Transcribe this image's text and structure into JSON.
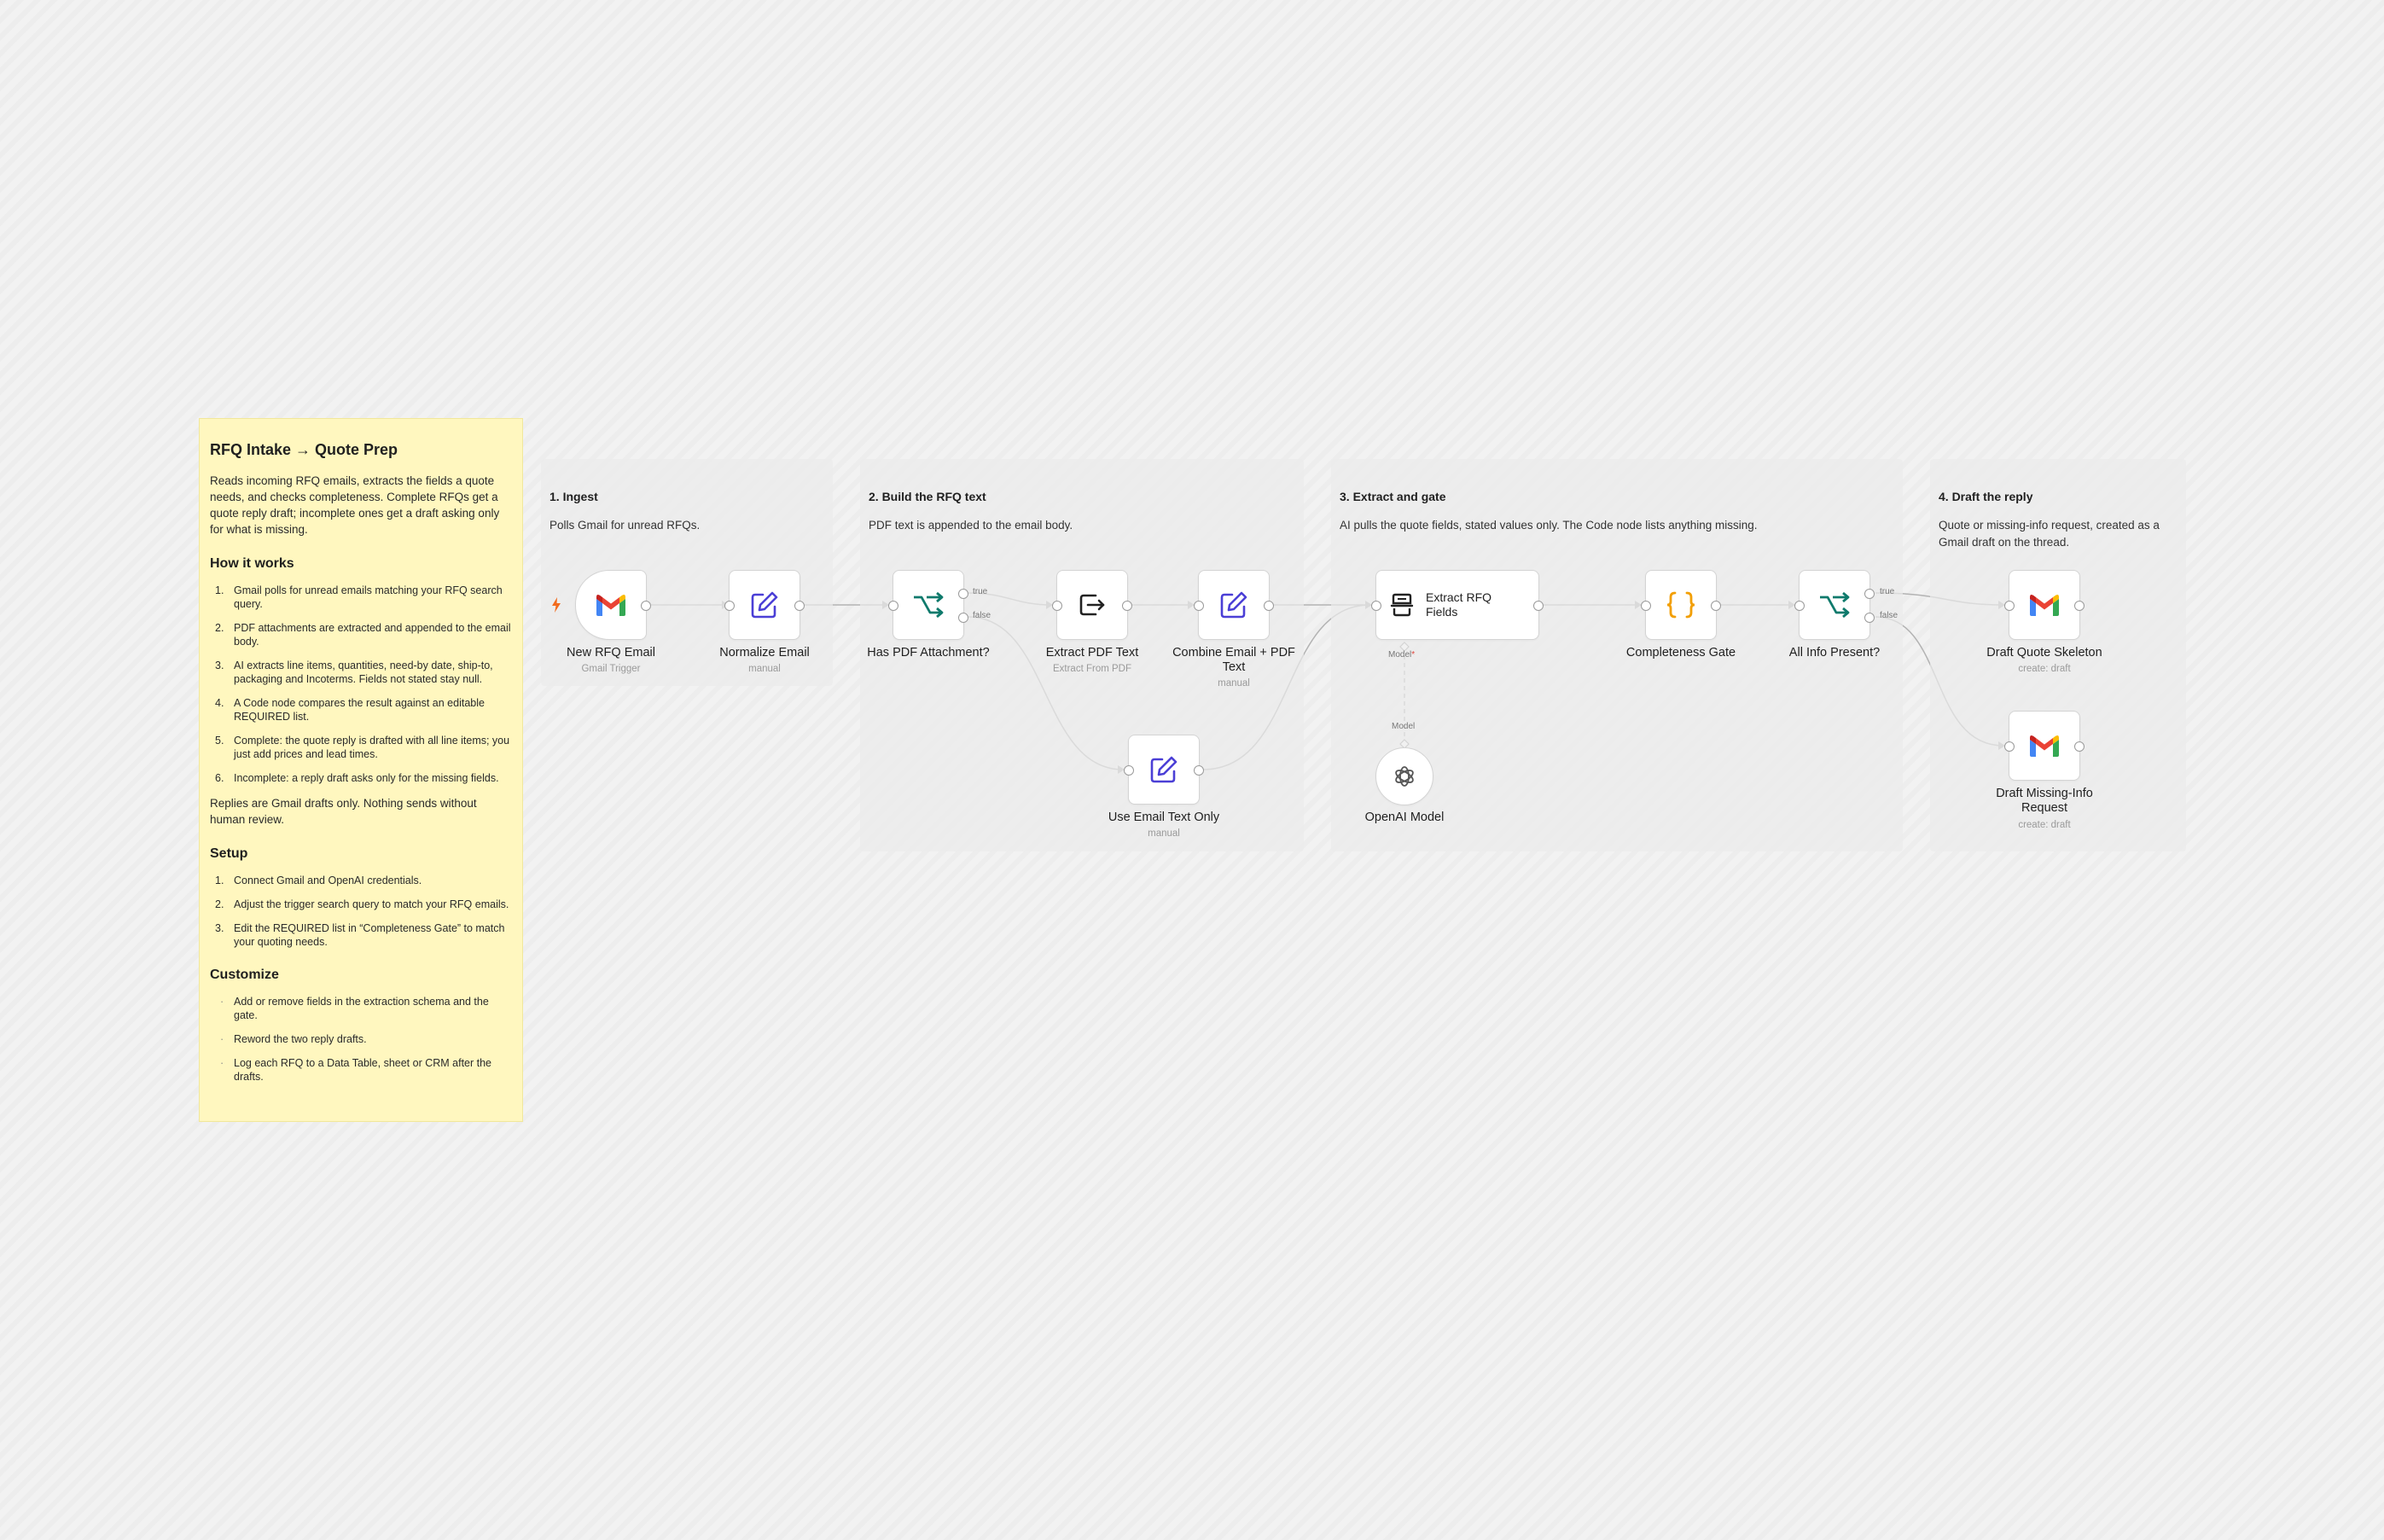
{
  "note": {
    "title": "RFQ Intake → Quote Prep",
    "intro": "Reads incoming RFQ emails, extracts the fields a quote needs, and checks completeness. Complete RFQs get a quote reply draft; incomplete ones get a draft asking only for what is missing.",
    "how_title": "How it works",
    "how_items": [
      "Gmail polls for unread emails matching your RFQ search query.",
      "PDF attachments are extracted and appended to the email body.",
      "AI extracts line items, quantities, need-by date, ship-to, packaging and Incoterms. Fields not stated stay null.",
      "A Code node compares the result against an editable REQUIRED list.",
      "Complete: the quote reply is drafted with all line items; you just add prices and lead times.",
      "Incomplete: a reply draft asks only for the missing fields."
    ],
    "replies": "Replies are Gmail drafts only. Nothing sends without human review.",
    "setup_title": "Setup",
    "setup_items": [
      "Connect Gmail and OpenAI credentials.",
      "Adjust the trigger search query to match your RFQ emails.",
      "Edit the REQUIRED list in “Completeness Gate” to match your quoting needs."
    ],
    "customize_title": "Customize",
    "customize_items": [
      "Add or remove fields in the extraction schema and the gate.",
      "Reword the two reply drafts.",
      "Log each RFQ to a Data Table, sheet or CRM after the drafts."
    ]
  },
  "sections": [
    {
      "title": "1. Ingest",
      "desc": "Polls Gmail for unread RFQs."
    },
    {
      "title": "2. Build the RFQ text",
      "desc": "PDF text is appended to the email body."
    },
    {
      "title": "3. Extract and gate",
      "desc": "AI pulls the quote fields, stated values only. The Code node lists anything missing."
    },
    {
      "title": "4. Draft the reply",
      "desc": "Quote or missing-info request, created as a Gmail draft on the thread."
    }
  ],
  "nodes": {
    "new_rfq_email": {
      "label": "New RFQ Email",
      "sub": "Gmail Trigger",
      "icon": "gmail-icon"
    },
    "normalize_email": {
      "label": "Normalize Email",
      "sub": "manual",
      "icon": "pencil-edit-icon"
    },
    "has_pdf": {
      "label": "Has PDF Attachment?",
      "icon": "if-branch-icon",
      "true_label": "true",
      "false_label": "false"
    },
    "extract_pdf": {
      "label": "Extract PDF Text",
      "sub": "Extract From PDF",
      "icon": "file-export-icon"
    },
    "combine": {
      "label": "Combine Email + PDF Text",
      "sub": "manual",
      "icon": "pencil-edit-icon"
    },
    "email_only": {
      "label": "Use Email Text Only",
      "sub": "manual",
      "icon": "pencil-edit-icon"
    },
    "extract_rfq": {
      "label": "Extract RFQ Fields",
      "icon": "document-extract-icon",
      "model_port": "Model",
      "model_required": "*"
    },
    "openai": {
      "label": "OpenAI Model",
      "icon": "openai-icon",
      "port_label": "Model"
    },
    "gate": {
      "label": "Completeness Gate",
      "icon": "code-braces-icon"
    },
    "all_info": {
      "label": "All Info Present?",
      "icon": "if-branch-icon",
      "true_label": "true",
      "false_label": "false"
    },
    "draft_quote": {
      "label": "Draft Quote Skeleton",
      "sub": "create: draft",
      "icon": "gmail-icon"
    },
    "draft_missing": {
      "label": "Draft Missing-Info Request",
      "sub": "create: draft",
      "icon": "gmail-icon"
    }
  },
  "colors": {
    "note_bg": "#fff7bf",
    "accent_purple": "#4b3fd6",
    "accent_teal": "#0f7a6c",
    "accent_orange": "#f29f05",
    "trigger_bolt": "#f26b1d"
  }
}
